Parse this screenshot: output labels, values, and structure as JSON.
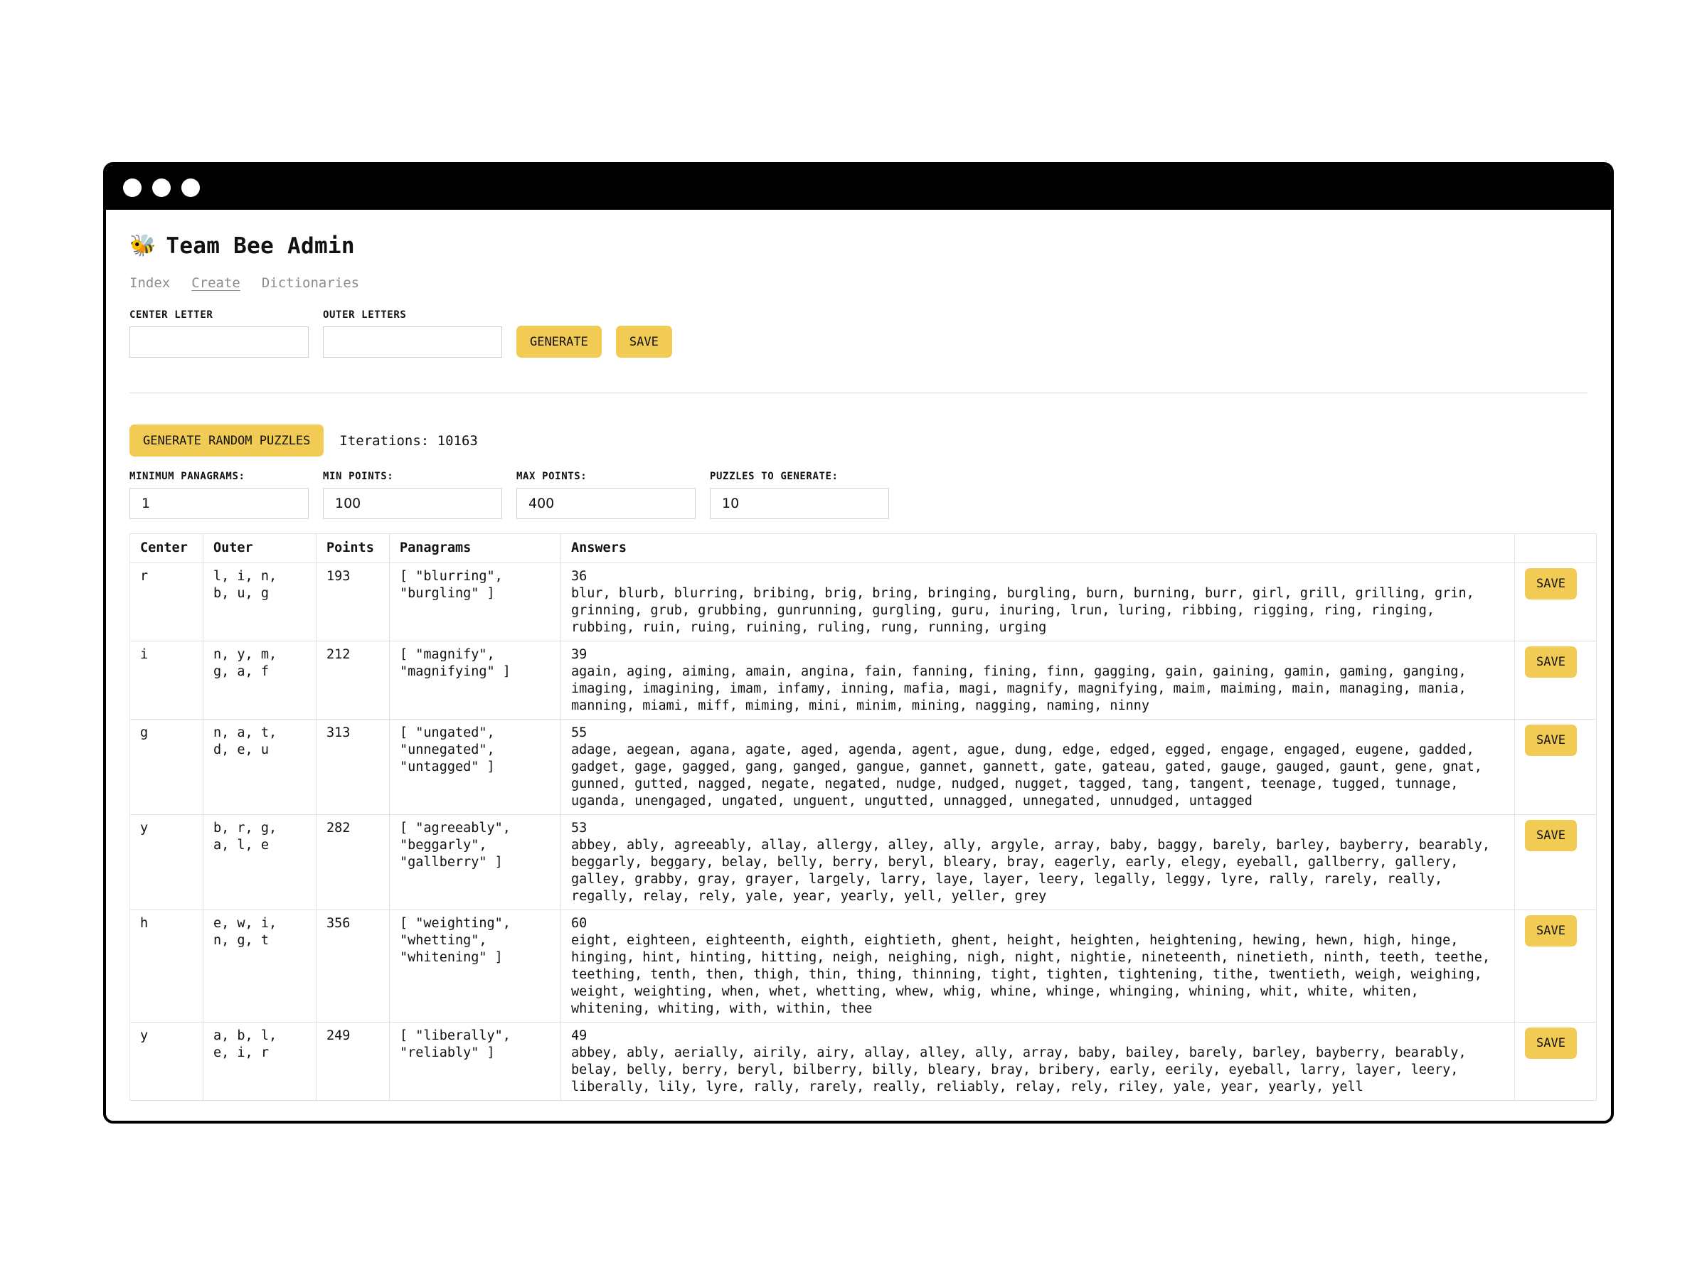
{
  "window": {
    "controls": [
      "close-dot",
      "minimize-dot",
      "maximize-dot"
    ]
  },
  "header": {
    "icon": "bee-icon",
    "emoji": "🐝",
    "title": "Team Bee Admin"
  },
  "nav": {
    "index": "Index",
    "create": "Create",
    "dictionaries": "Dictionaries",
    "active": "Create"
  },
  "create_form": {
    "center_label": "CENTER LETTER",
    "center_value": "",
    "outer_label": "OUTER LETTERS",
    "outer_value": "",
    "generate_label": "GENERATE",
    "save_label": "SAVE"
  },
  "random": {
    "button_label": "GENERATE RANDOM PUZZLES",
    "iterations_text": "Iterations: 10163"
  },
  "filters": {
    "min_panagrams_label": "MINIMUM PANAGRAMS:",
    "min_panagrams_value": "1",
    "min_points_label": "MIN POINTS:",
    "min_points_value": "100",
    "max_points_label": "MAX POINTS:",
    "max_points_value": "400",
    "puzzles_label": "PUZZLES TO GENERATE:",
    "puzzles_value": "10"
  },
  "table": {
    "headers": {
      "center": "Center",
      "outer": "Outer",
      "points": "Points",
      "panagrams": "Panagrams",
      "answers": "Answers",
      "action": ""
    },
    "save_label": "SAVE",
    "rows": [
      {
        "center": "r",
        "outer": "l, i, n,\nb, u, g",
        "points": "193",
        "panagrams": "[ \"blurring\",\n\"burgling\" ]",
        "count": "36",
        "answers": "blur, blurb, blurring, bribing, brig, bring, bringing, burgling, burn, burning, burr, girl, grill, grilling, grin, grinning, grub, grubbing, gunrunning, gurgling, guru, inuring, lrun, luring, ribbing, rigging, ring, ringing, rubbing, ruin, ruing, ruining, ruling, rung, running, urging"
      },
      {
        "center": "i",
        "outer": "n, y, m,\ng, a, f",
        "points": "212",
        "panagrams": "[ \"magnify\",\n\"magnifying\" ]",
        "count": "39",
        "answers": "again, aging, aiming, amain, angina, fain, fanning, fining, finn, gagging, gain, gaining, gamin, gaming, ganging, imaging, imagining, imam, infamy, inning, mafia, magi, magnify, magnifying, maim, maiming, main, managing, mania, manning, miami, miff, miming, mini, minim, mining, nagging, naming, ninny"
      },
      {
        "center": "g",
        "outer": "n, a, t,\nd, e, u",
        "points": "313",
        "panagrams": "[ \"ungated\",\n\"unnegated\",\n\"untagged\" ]",
        "count": "55",
        "answers": "adage, aegean, agana, agate, aged, agenda, agent, ague, dung, edge, edged, egged, engage, engaged, eugene, gadded, gadget, gage, gagged, gang, ganged, gangue, gannet, gannett, gate, gateau, gated, gauge, gauged, gaunt, gene, gnat, gunned, gutted, nagged, negate, negated, nudge, nudged, nugget, tagged, tang, tangent, teenage, tugged, tunnage, uganda, unengaged, ungated, unguent, ungutted, unnagged, unnegated, unnudged, untagged"
      },
      {
        "center": "y",
        "outer": "b, r, g,\na, l, e",
        "points": "282",
        "panagrams": "[ \"agreeably\",\n\"beggarly\",\n\"gallberry\" ]",
        "count": "53",
        "answers": "abbey, ably, agreeably, allay, allergy, alley, ally, argyle, array, baby, baggy, barely, barley, bayberry, bearably, beggarly, beggary, belay, belly, berry, beryl, bleary, bray, eagerly, early, elegy, eyeball, gallberry, gallery, galley, grabby, gray, grayer, largely, larry, laye, layer, leery, legally, leggy, lyre, rally, rarely, really, regally, relay, rely, yale, year, yearly, yell, yeller, grey"
      },
      {
        "center": "h",
        "outer": "e, w, i,\nn, g, t",
        "points": "356",
        "panagrams": "[ \"weighting\",\n\"whetting\",\n\"whitening\" ]",
        "count": "60",
        "answers": "eight, eighteen, eighteenth, eighth, eightieth, ghent, height, heighten, heightening, hewing, hewn, high, hinge, hinging, hint, hinting, hitting, neigh, neighing, nigh, night, nightie, nineteenth, ninetieth, ninth, teeth, teethe, teething, tenth, then, thigh, thin, thing, thinning, tight, tighten, tightening, tithe, twentieth, weigh, weighing, weight, weighting, when, whet, whetting, whew, whig, whine, whinge, whinging, whining, whit, white, whiten, whitening, whiting, with, within, thee"
      },
      {
        "center": "y",
        "outer": "a, b, l,\ne, i, r",
        "points": "249",
        "panagrams": "[ \"liberally\",\n\"reliably\" ]",
        "count": "49",
        "answers": "abbey, ably, aerially, airily, airy, allay, alley, ally, array, baby, bailey, barely, barley, bayberry, bearably, belay, belly, berry, beryl, bilberry, billy, bleary, bray, bribery, early, eerily, eyeball, larry, layer, leery, liberally, lily, lyre, rally, rarely, really, reliably, relay, rely, riley, yale, year, yearly, yell"
      }
    ]
  }
}
